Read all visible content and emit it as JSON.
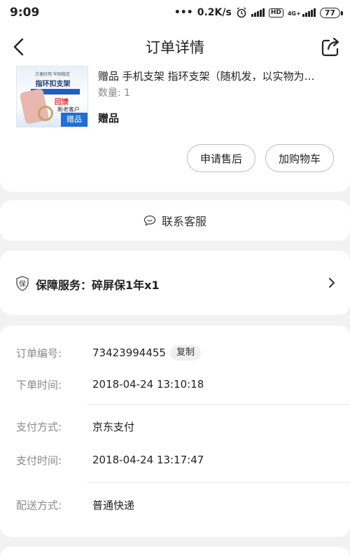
{
  "status_bar": {
    "time": "9:09",
    "network_speed": "0.2K/s",
    "hd_label": "HD",
    "network_type": "4G+",
    "battery": "77"
  },
  "nav": {
    "title": "订单详情",
    "back_icon": "back-arrow-icon",
    "share_icon": "share-icon"
  },
  "product": {
    "thumbnail": {
      "line1": "方便好用 牢固稳定",
      "line2": "指环扣支架",
      "line3": "回馈",
      "line4": "新老客户",
      "badge": "赠品"
    },
    "name": "赠品 手机支架 指环支架（随机发，以实物为…",
    "quantity": "数量: 1",
    "gift_label": "赠品",
    "buttons": {
      "after_sale": "申请售后",
      "add_cart": "加购物车"
    }
  },
  "customer_service": {
    "label": "联系客服",
    "icon": "chat-bubble-icon"
  },
  "protection": {
    "badge": "保",
    "label": "保障服务：碎屏保1年x1"
  },
  "order_info": {
    "rows": [
      {
        "key": "订单编号:",
        "value": "73423994455"
      },
      {
        "key": "下单时间:",
        "value": "2018-04-24 13:10:18"
      },
      {
        "key": "支付方式:",
        "value": "京东支付"
      },
      {
        "key": "支付时间:",
        "value": "2018-04-24 13:17:47"
      },
      {
        "key": "配送方式:",
        "value": "普通快递"
      }
    ],
    "copy_label": "复制"
  },
  "colors": {
    "background": "#f2f2f2",
    "card": "#ffffff",
    "muted_text": "#8a8a8a"
  }
}
